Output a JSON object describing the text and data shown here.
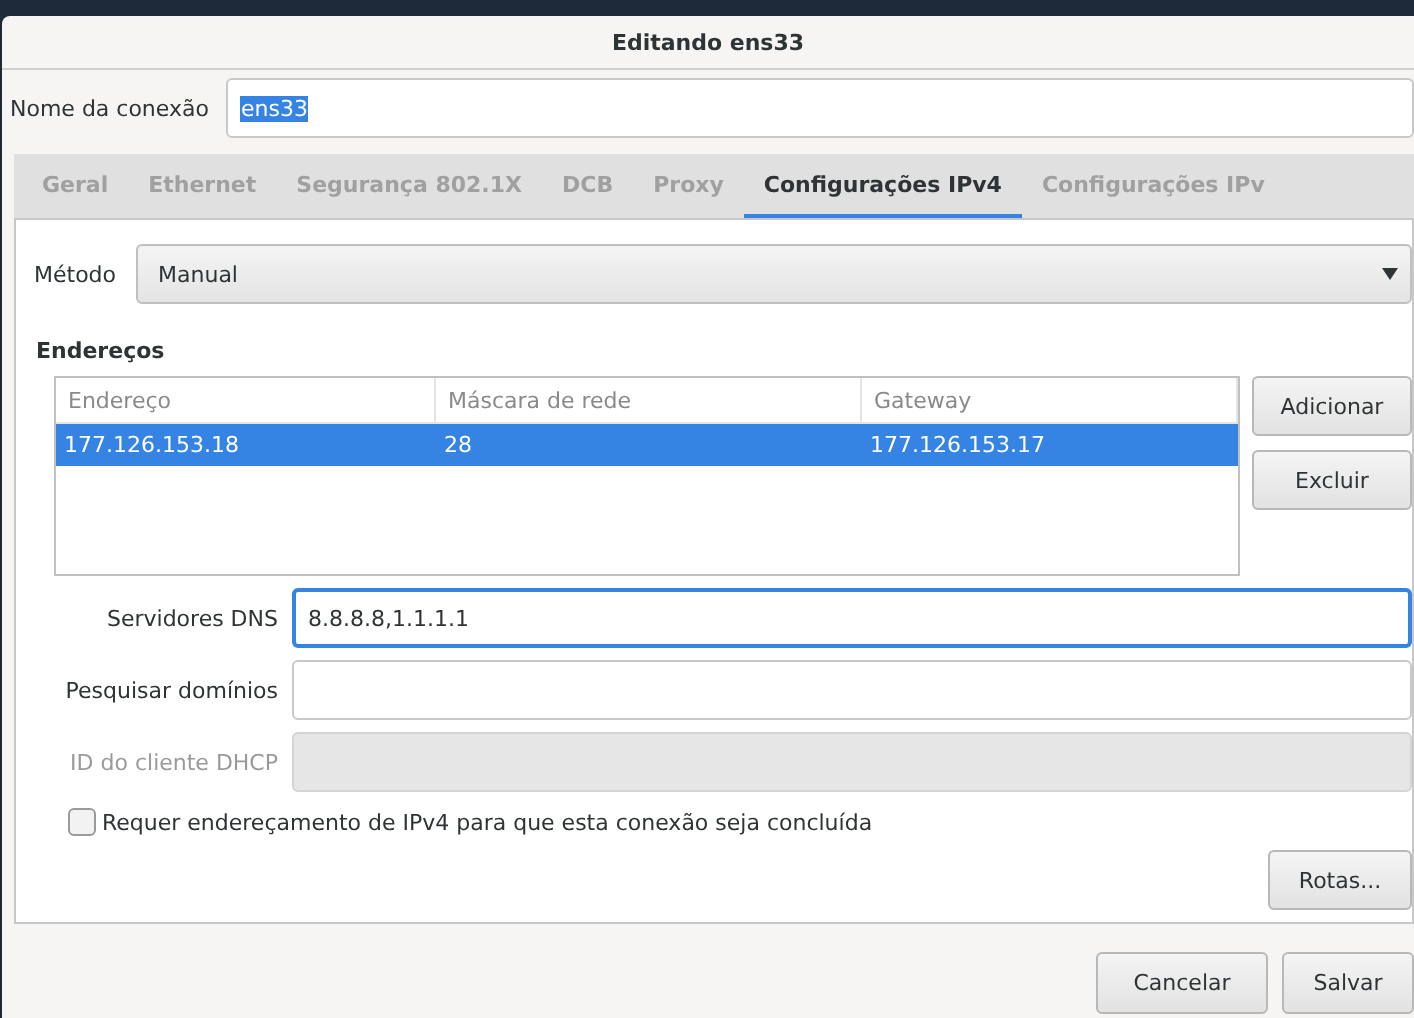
{
  "window": {
    "title": "Editando ens33"
  },
  "connection_name": {
    "label": "Nome da conexão",
    "value": "ens33",
    "text_selected": true
  },
  "tabs": [
    {
      "label": "Geral",
      "selected": false
    },
    {
      "label": "Ethernet",
      "selected": false
    },
    {
      "label": "Segurança 802.1X",
      "selected": false
    },
    {
      "label": "DCB",
      "selected": false
    },
    {
      "label": "Proxy",
      "selected": false
    },
    {
      "label": "Configurações IPv4",
      "selected": true
    },
    {
      "label": "Configurações IPv",
      "selected": false
    }
  ],
  "method": {
    "label": "Método",
    "value": "Manual"
  },
  "addresses": {
    "heading": "Endereços",
    "columns": [
      "Endereço",
      "Máscara de rede",
      "Gateway"
    ],
    "rows": [
      {
        "cells": [
          "177.126.153.18",
          "28",
          "177.126.153.17"
        ],
        "selected": true
      }
    ],
    "buttons": [
      "Adicionar",
      "Excluir"
    ]
  },
  "fields": [
    {
      "label": "Servidores DNS",
      "value": "8.8.8.8,1.1.1.1",
      "focused": true,
      "disabled": false
    },
    {
      "label": "Pesquisar domínios",
      "focused": false,
      "disabled": false
    },
    {
      "label": "ID do cliente DHCP",
      "focused": false,
      "disabled": true
    }
  ],
  "require_checkbox": {
    "label": "Requer endereçamento de IPv4 para que esta conexão seja concluída",
    "checked": false
  },
  "routes_button": "Rotas...",
  "footer_buttons": [
    "Cancelar",
    "Salvar"
  ]
}
